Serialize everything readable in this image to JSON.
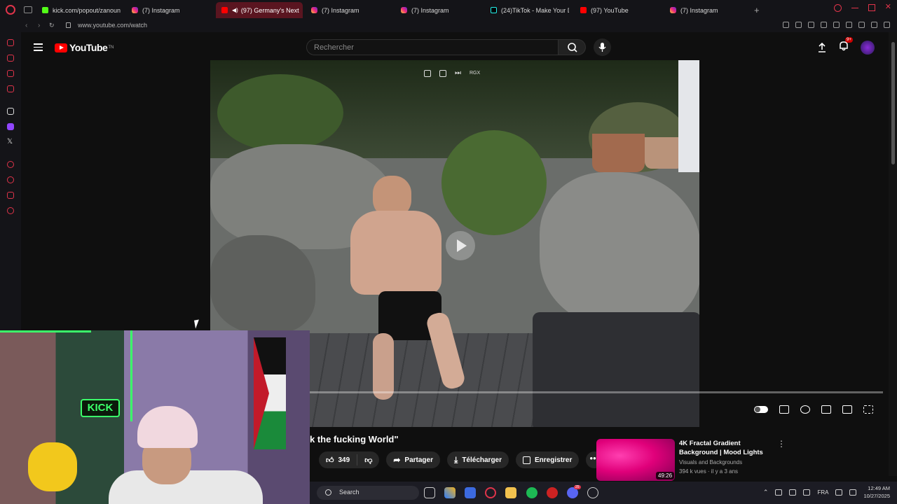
{
  "browser": {
    "tabs": [
      {
        "label": "kick.com/popout/zanoun",
        "favicon": "kick-icon"
      },
      {
        "label": "(7) Instagram",
        "favicon": "instagram-icon"
      },
      {
        "label": "(97) Germany's Next",
        "favicon": "youtube-icon",
        "active": true
      },
      {
        "label": "(7) Instagram",
        "favicon": "instagram-icon"
      },
      {
        "label": "(7) Instagram",
        "favicon": "instagram-icon"
      },
      {
        "label": "(24)TikTok - Make Your D",
        "favicon": "tiktok-icon"
      },
      {
        "label": "(97) YouTube",
        "favicon": "youtube-icon"
      },
      {
        "label": "(7) Instagram",
        "favicon": "instagram-icon"
      }
    ],
    "new_tab": "+",
    "url": "www.youtube.com/watch",
    "accent_color": "#e0344a"
  },
  "youtube": {
    "logo_text": "YouTube",
    "country_code": "TN",
    "search_placeholder": "Rechercher",
    "notification_badge": "9+"
  },
  "player": {
    "overlay_label": "RGX",
    "progress_fraction": 0.0
  },
  "video": {
    "title": "k the fucking World\"",
    "likes": "349",
    "share_label": "Partager",
    "download_label": "Télécharger",
    "save_label": "Enregistrer",
    "more_label": "•••"
  },
  "recommendation": {
    "title": "4K Fractal Gradient Background | Mood Lights",
    "channel": "Visuals and Backgrounds",
    "meta": "394 k vues · il y a 3 ans",
    "duration": "49:26",
    "menu": "⋮"
  },
  "webcam": {
    "sign_text": "KICK"
  },
  "taskbar": {
    "search_label": "Search",
    "language": "FRA",
    "time": "12:49 AM",
    "date": "10/27/2025",
    "discord_badge": "25"
  }
}
